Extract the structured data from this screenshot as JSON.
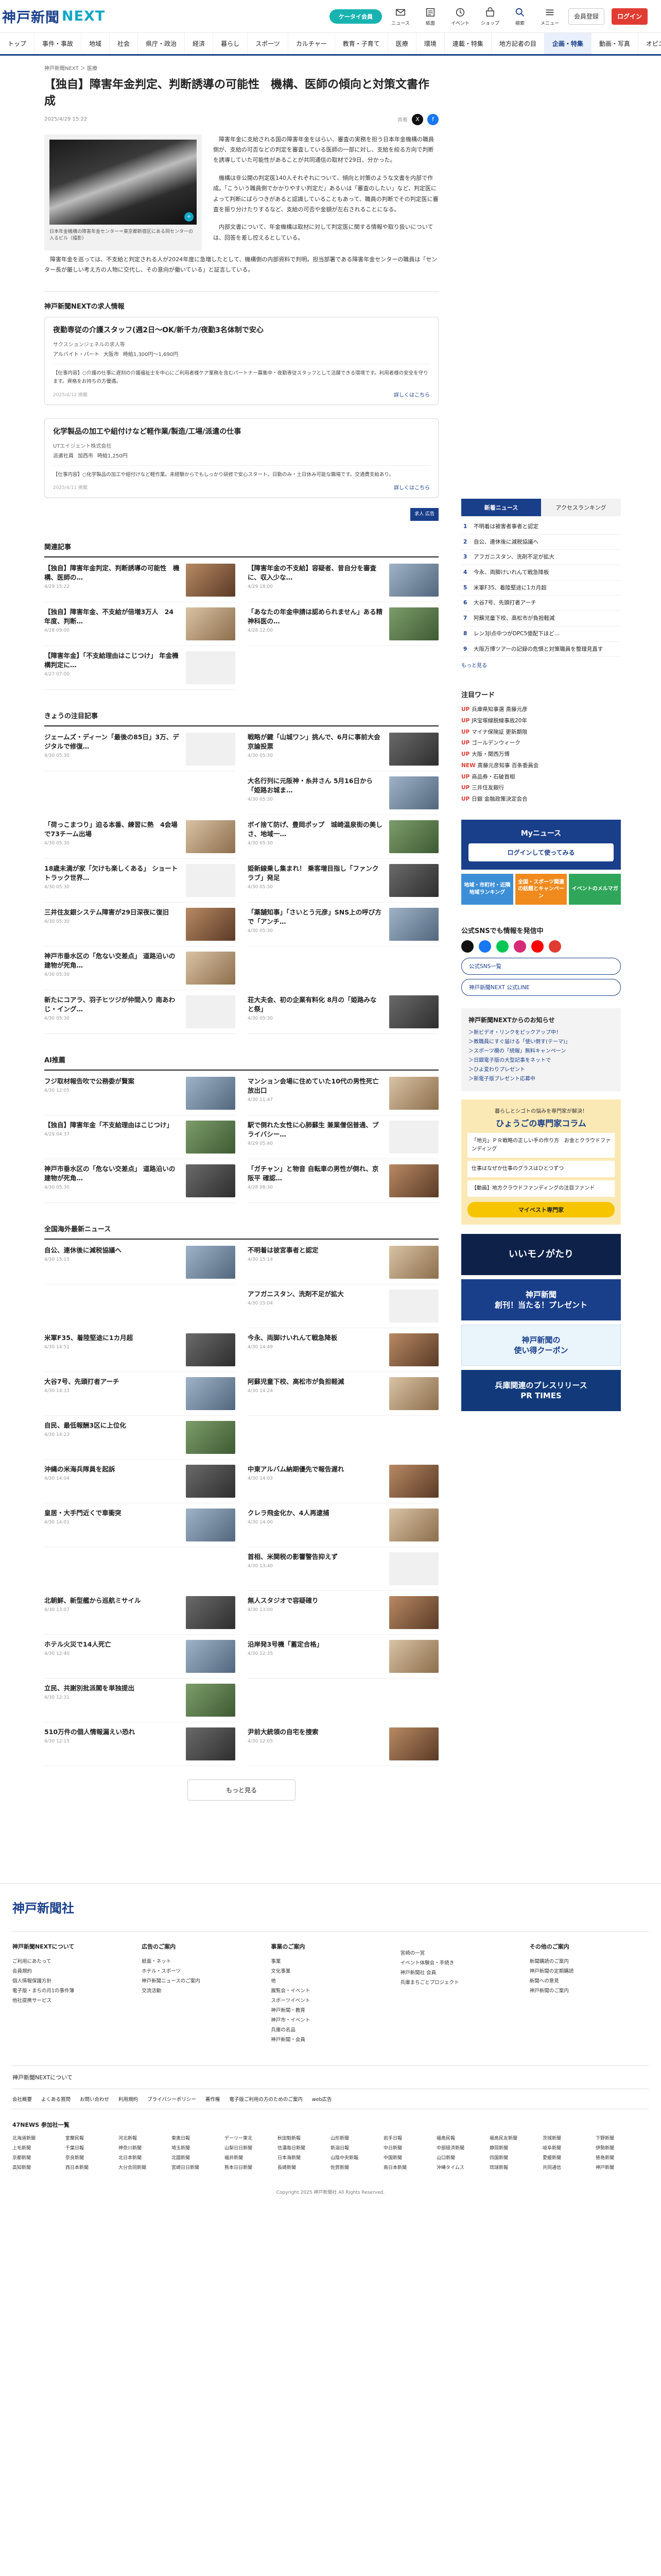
{
  "header": {
    "logo_main": "神戸新聞",
    "logo_sub": "NEXT",
    "pill": "ケータイ会員",
    "icons": [
      {
        "name": "mail-icon",
        "label": "ニュース"
      },
      {
        "name": "paper-icon",
        "label": "紙面"
      },
      {
        "name": "clock-icon",
        "label": "イベント"
      },
      {
        "name": "store-icon",
        "label": "ショップ"
      },
      {
        "name": "search-icon",
        "label": "検索"
      },
      {
        "name": "menu-icon",
        "label": "メニュー"
      }
    ],
    "register": "会員登録",
    "login": "ログイン"
  },
  "nav": [
    "トップ",
    "事件・事故",
    "地域",
    "社会",
    "県庁・政治",
    "経済",
    "暮らし",
    "スポーツ",
    "カルチャー",
    "教育・子育て",
    "医療",
    "環境",
    "連載・特集",
    "地方記者の目",
    "企画・特集",
    "動画・写真",
    "オピニオン"
  ],
  "breadcrumb": "神戸新聞NEXT ＞ 医療",
  "article": {
    "title": "【独自】障害年金判定、判断誘導の可能性　機構、医師の傾向と対策文書作成",
    "date": "2025/4/29 15:22",
    "share_label": "共有",
    "caption": "日本年金機構の障害年金センター＝東京都新宿区にある同センターの入るビル（撮影）",
    "paragraphs": [
      "障害年金に支給される国の障害年金をはらい、審査の実務を担う日本年金機構の職員側が、支給の可否などの判定を審査している医師の一部に対し、支給を絞る方向で判断を誘導していた可能性があることが共同通信の取材で29日、分かった。",
      "機構は非公開の判定医140人それぞれについて、傾向と対策のような文書を内部で作成。「こういう職員側でかかりやすい判定だ」あるいは「審査のしたい」など、判定医によって判断にばらつきがあると認識していることもあって、職員の判断でその判定医に審査を振り分けたりするなど、支給の可否や金額が左右されることになる。",
      "内部文書について、年金機構は取材に対して判定医に関する情報や取り扱いについては、回答を差し控えるとしている。"
    ],
    "wide": "障害年金を巡っては、不支給と判定される人が2024年度に急増したとして、機構側の内部資料で判明。担当部署である障害年金センターの職員は「センター長が厳しい考え方の人物に交代し、その意向が働いている」と証言している。"
  },
  "jobs": {
    "heading": "神戸新聞NEXTの求人情報",
    "items": [
      {
        "title": "夜勤専従の介護スタッフ(週2日～OK/新千カ/夜勤3名体制で安心",
        "company": "サクスションジェネルの求人等",
        "tags": [
          "アルバイト・パート",
          "大阪市",
          "時給1,300円～1,690円"
        ],
        "desc": "【仕事内容】○介護の仕事に遅刻の介護福祉士を中心にご利用者様ケア業務を含むパートナー募集中・夜勤専従スタッフとして活躍できる環境です。利用者様の安全を守ります。資格をお持ちの方優遇。",
        "date": "2025/4/12 掲載",
        "more": "詳しくはこちら"
      },
      {
        "title": "化学製品の加工や組付けなど軽作業/製造/工場/派遣の仕事",
        "company": "UTエイジェント株式会社",
        "tags": [
          "派遣社員",
          "加西市",
          "時給1,250円"
        ],
        "desc": "【仕事内容】○化学製品の加工や組付けなど軽作業。未経験からでもしっかり研修で安心スタート。日勤のみ・土日休み可能な職場です。交通費支給あり。",
        "date": "2025/4/11 掲載",
        "more": "詳しくはこちら"
      }
    ],
    "ad": "求人\n広告"
  },
  "related": {
    "heading": "関連記事",
    "items": [
      {
        "t": "【独自】障害年金判定、判断誘導の可能性　機構、医師の…",
        "d": "4/29 15:22"
      },
      {
        "t": "【障害年金の不支給】容疑者、昔自分を審査に、収入少な…",
        "d": "4/29 18:00"
      },
      {
        "t": "【独自】障害年金、不支給が倍増3万人　24年度、判断…",
        "d": "4/28 09:00"
      },
      {
        "t": "「あなたの年金申請は認められません」ある精神科医の…",
        "d": "4/28 12:00"
      },
      {
        "t": "【障害年金】「不支給理由はこじつけ」 年金機構判定に…",
        "d": "4/27 07:00"
      }
    ]
  },
  "today": {
    "heading": "きょうの注目記事",
    "items": [
      {
        "t": "ジェームズ・ディーン「最後の85日」3万、デジタルで修復…",
        "d": "4/30 05:30"
      },
      {
        "t": "戦略が鍵「山城ワン」挑んで、6月に事前大会 京論投票",
        "d": "4/30 05:30"
      },
      {
        "t": "",
        "d": ""
      },
      {
        "t": "大名行列に元阪神・糸井さん 5月16日から「姫路お城ま…",
        "d": "4/30 05:30"
      },
      {
        "t": "「荷っこまつり」迫る本番、練習に熱　4会場で73チーム出場",
        "d": "4/30 05:30"
      },
      {
        "t": "ボイ捨て防げ、豊岡ポップ　城崎温泉街の美しさ、地域一…",
        "d": "4/30 05:30"
      },
      {
        "t": "18歳未満が家「欠けも楽しくある」 ショートトラック世界…",
        "d": "4/30 05:30"
      },
      {
        "t": "姫新線乗し集まれ！ 乗客増目指し「ファンクラブ」発足",
        "d": "4/30 05:30"
      },
      {
        "t": "三井住友銀システム障害が29日深夜に復旧",
        "d": "4/30 05:30"
      },
      {
        "t": "「薬舗知事」「さいとう元彦」SNS上の呼び方で「アンチ…",
        "d": "4/30 05:30"
      },
      {
        "t": "神戸市垂水区の「危ない交差点」 道路沿いの建物が死角…",
        "d": "4/30 05:30"
      },
      {
        "t": "",
        "d": ""
      },
      {
        "t": "新たにコアラ、羽子ヒツジが仲間入り 南あわじ・イング…",
        "d": "4/30 05:30"
      },
      {
        "t": "荘大夫会、初の企業有料化 8月の「姫路みなと祭」",
        "d": "4/30 05:30"
      }
    ]
  },
  "ai": {
    "heading": "AI推薦",
    "items": [
      {
        "t": "フジ取材報告吹で公務委が賢案",
        "d": "4/30 12:05"
      },
      {
        "t": "マンション会場に住めていた10代の男性死亡 放出口",
        "d": "4/30 11:47"
      },
      {
        "t": "【独自】障害年金「不支給理由はこじつけ」",
        "d": "4/29 04:37"
      },
      {
        "t": "駅で倒れた女性に心肺蘇生 兼業僧侶普通、プライバシー…",
        "d": "4/29 05:40"
      },
      {
        "t": "神戸市垂水区の「危ない交差点」 道路沿いの建物が死角…",
        "d": "4/30 05:30"
      },
      {
        "t": "「ガチャン」と物音 自転車の男性が倒れ、京阪平 確認…",
        "d": "4/28 08:30"
      }
    ]
  },
  "national": {
    "heading": "全国海外最新ニュース",
    "items": [
      {
        "t": "自公、連休後に減税協議へ",
        "d": "4/30 15:15"
      },
      {
        "t": "不明着は彼宮事者と認定",
        "d": "4/30 15:14"
      },
      {
        "t": "",
        "d": ""
      },
      {
        "t": "アフガニスタン、洗剤不足が拡大",
        "d": "4/30 15:04"
      },
      {
        "t": "米軍F35、着陸堅途に1カ月超",
        "d": "4/30 14:51"
      },
      {
        "t": "今永、両脚けいれんて戦急降板",
        "d": "4/30 14:49"
      },
      {
        "t": "大谷7号、先頭打者アーチ",
        "d": "4/30 14:33"
      },
      {
        "t": "阿蘇児童下校、高松市が負担軽減",
        "d": "4/30 14:24"
      },
      {
        "t": "自民、最低報酬3区に上位化",
        "d": "4/30 14:23"
      },
      {
        "t": "",
        "d": ""
      },
      {
        "t": "沖縄の米海兵隊員を起訴",
        "d": "4/30 14:04"
      },
      {
        "t": "中東アルバム納期優先で報告遅れ",
        "d": "4/30 14:03"
      },
      {
        "t": "皇居・大手門近くで車衝突",
        "d": "4/30 14:01"
      },
      {
        "t": "クレラ飛金化か、4人再逮捕",
        "d": "4/30 14:00"
      },
      {
        "t": "",
        "d": ""
      },
      {
        "t": "首相、米関税の影響警告抑えず",
        "d": "4/30 13:40"
      },
      {
        "t": "北朝鮮、新型艦から巡航ミサイル",
        "d": "4/30 13:07"
      },
      {
        "t": "無人スタジオで容疑確り",
        "d": "4/30 13:00"
      },
      {
        "t": "ホテル火災で14人死亡",
        "d": "4/30 12:40"
      },
      {
        "t": "沿岸発3号機「蓄定合格」",
        "d": "4/30 12:35"
      },
      {
        "t": "立民、共謝別批派閣を単独提出",
        "d": "4/30 12:31"
      },
      {
        "t": "",
        "d": ""
      },
      {
        "t": "510万件の個人情報漏えい恐れ",
        "d": "4/30 12:15"
      },
      {
        "t": "尹前大統領の自宅を捜索",
        "d": "4/30 12:05"
      }
    ],
    "more": "もっと見る"
  },
  "side": {
    "tabs": [
      "新着ニュース",
      "アクセスランキング"
    ],
    "rank": [
      "不明着は被害者事者と認定",
      "自公、連休後に減税協議へ",
      "アフガニスタン、洗剤不足が拡大",
      "今永、両脚けいれんて戦急降板",
      "米軍F35、着陸堅途に1カ月超",
      "大谷7号、先頭打者アーチ",
      "阿蘇児童下校、高松市が負担軽減",
      "レン3Jl点中つがDPC5億配下ほど…",
      "大阪万博ツアーの記録の危惧と対策職員を整理見直す"
    ],
    "more": "もっと見る",
    "kw_heading": "注目ワード",
    "kw": [
      {
        "m": "UP",
        "t": "兵庫県知事選 斎藤元彦"
      },
      {
        "m": "UP",
        "t": "JR宝塚線脱線事故20年"
      },
      {
        "m": "UP",
        "t": "マイナ保険証 更新期限"
      },
      {
        "m": "UP",
        "t": "ゴールデンウィーク"
      },
      {
        "m": "UP",
        "t": "大阪・関西万博"
      },
      {
        "m": "NEW",
        "t": "斎藤元彦知事 百条委員会"
      },
      {
        "m": "UP",
        "t": "商品券・石破首相"
      },
      {
        "m": "UP",
        "t": "三井住友銀行"
      },
      {
        "m": "UP",
        "t": "日銀 金融政策決定会合"
      }
    ],
    "my_title": "Myニュース",
    "my_btn": "ログインして使ってみる",
    "tiles": [
      "地域・市町村・近隣地域ランキング",
      "全国・スポーツ関連の話題とキャンペーン",
      "イベントのメルマガ"
    ],
    "sns_heading": "公式SNSでも情報を発信中",
    "sns_out": [
      "公式SNS一覧",
      "神戸新聞NEXT 公式LINE"
    ],
    "notice_h": "神戸新聞NEXTからのお知らせ",
    "notice": [
      "＞新ビデオ・リンクをピックアップ中！",
      "＞教職員にすぐ届ける「使い倒す(テーマ)」",
      "＞スポーツ欄の「続報」無料キャンペーン",
      "＞日銀電子版の大型記事をネットで",
      "＞ひよ変わりプレゼント",
      "＞新電子版プレゼント応募中"
    ],
    "yb_t1": "暮らしとシゴトの悩みを専門家が解決！",
    "yb_t2": "ひょうごの専門家コラム",
    "yb_card": [
      "「地元」ＰＲ戦略の正しい手の作り方　お金とクラウドファンディング",
      "仕事はなぜか仕事のグラスはひとつずつ",
      "【動画】地方クラウドファンディングの注目ファンド"
    ],
    "yb_btn": "マイベスト専門家",
    "banners": [
      "いいモノがたり",
      "神戸新聞\n創刊！当たる！プレゼント",
      "神戸新聞の\n使い得クーポン",
      "兵庫関連のプレスリリース\nPR TIMES"
    ]
  },
  "footer": {
    "logo": "神戸新聞社",
    "cols": [
      {
        "h": "神戸新聞NEXTについて",
        "l": [
          "ご利用にあたって",
          "会員規約",
          "個人情報保護方針",
          "電子版・まちの月1の事件簿",
          "他社提携サービス"
        ]
      },
      {
        "h": "広告のご案内",
        "l": [
          "紙面・ネット",
          "ホテル・スポーツ",
          "神戸新聞ニュースのご案内",
          "交流活動"
        ]
      },
      {
        "h": "事業のご案内",
        "l": [
          "事業",
          "文化事業",
          "他",
          "展覧会・イベント",
          "スポーツイベント",
          "神戸新聞・教育",
          "神戸市・イベント",
          "兵庫の名品",
          "神戸新聞・会員"
        ]
      },
      {
        "h": "",
        "l": [
          "宮崎の一宮",
          "イベント体験会・手続き",
          "神戸新聞社 会員",
          "兵庫まちごとプロジェクト"
        ]
      },
      {
        "h": "その他のご案内",
        "l": [
          "新聞購読のご案内",
          "神戸新聞の定期購読",
          "新聞への意見",
          "神戸新聞のご案内"
        ]
      }
    ],
    "bar": "神戸新聞NEXTについて",
    "links": [
      "会社概要",
      "よくある質問",
      "お問い合わせ",
      "利用規約",
      "プライバシーポリシー",
      "著作権",
      "電子版ご利用の方のためのご案内",
      "web広告"
    ],
    "net_h": "47NEWS 参加社一覧",
    "net": [
      "北海道新聞",
      "室蘭民報",
      "河北新報",
      "東奥日報",
      "デーリー東北",
      "秋田魁新報",
      "山形新聞",
      "岩手日報",
      "福島民報",
      "福島民友新聞",
      "茨城新聞",
      "下野新聞",
      "上毛新聞",
      "千葉日報",
      "神奈川新聞",
      "埼玉新聞",
      "山梨日日新聞",
      "信濃毎日新聞",
      "新潟日報",
      "中日新聞",
      "中部経済新聞",
      "静岡新聞",
      "岐阜新聞",
      "伊勢新聞",
      "京都新聞",
      "奈良新聞",
      "北日本新聞",
      "北國新聞",
      "福井新聞",
      "日本海新聞",
      "山陰中央新報",
      "中国新聞",
      "山口新聞",
      "四国新聞",
      "愛媛新聞",
      "徳島新聞",
      "高知新聞",
      "西日本新聞",
      "大分合同新聞",
      "宮崎日日新聞",
      "熊本日日新聞",
      "長崎新聞",
      "佐賀新聞",
      "南日本新聞",
      "沖縄タイムス",
      "琉球新報",
      "共同通信",
      "神戸新聞"
    ],
    "copy": "Copyright 2025 神戸新聞社 All Rights Reserved."
  }
}
